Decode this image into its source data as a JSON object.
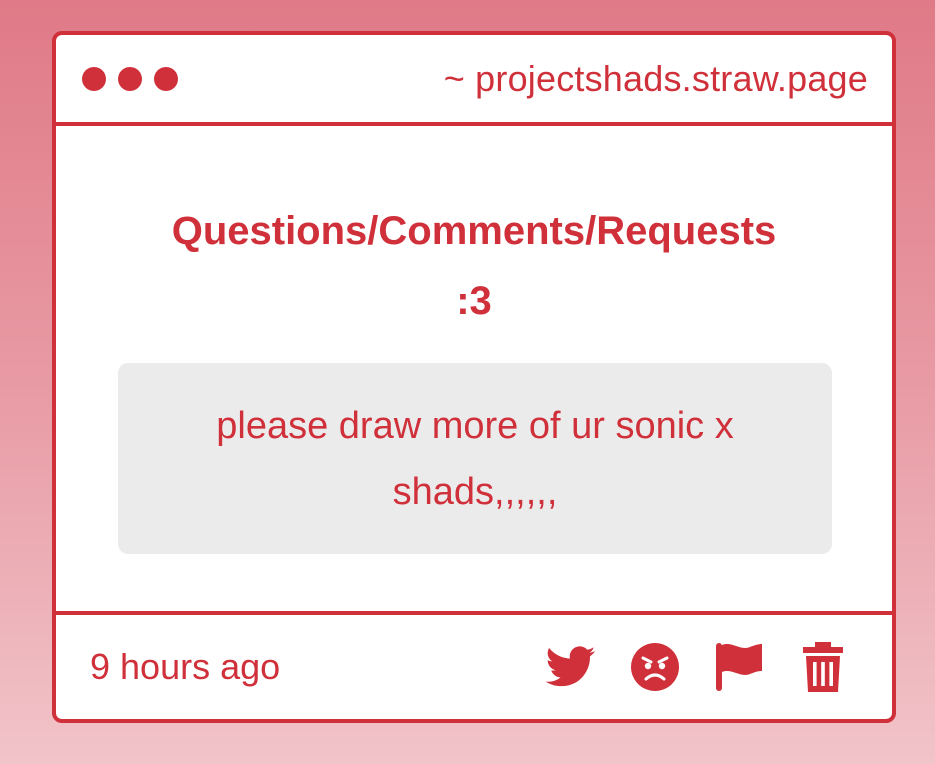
{
  "window": {
    "url": "~ projectshads.straw.page"
  },
  "post": {
    "heading_line1": "Questions/Comments/Requests",
    "heading_line2": ":3",
    "message_line1": "please draw more of ur sonic x",
    "message_line2": "shads,,,,,,"
  },
  "footer": {
    "time": "9 hours ago",
    "actions": [
      "twitter-icon",
      "angry-face-icon",
      "flag-icon",
      "trash-icon"
    ]
  },
  "colors": {
    "accent": "#d0303a",
    "message_bg": "#ecebec",
    "background_top": "#e07a87",
    "background_bottom": "#f1c4c9"
  }
}
